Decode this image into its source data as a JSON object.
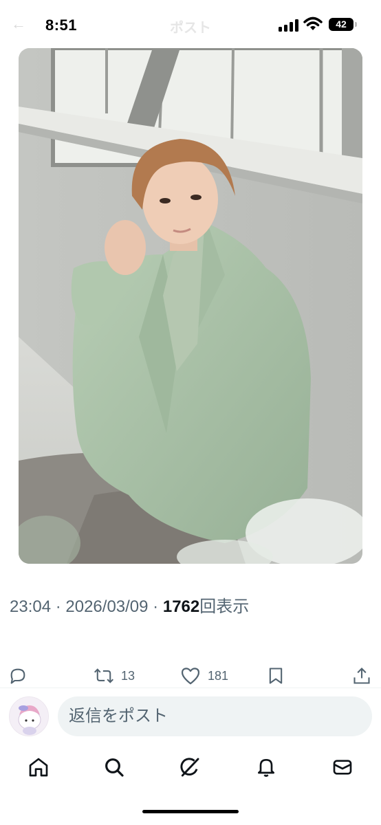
{
  "status_bar": {
    "time": "8:51",
    "battery": "42"
  },
  "header": {
    "title": "ポスト",
    "back_icon": "arrow-left-icon"
  },
  "post": {
    "image_alt": "photo",
    "timestamp": "23:04 · 2026/03/09 · ",
    "views": "1762",
    "views_suffix": "回表示"
  },
  "actions": {
    "reply_icon": "reply-icon",
    "repost_icon": "repost-icon",
    "repost_count": "13",
    "like_icon": "heart-icon",
    "like_count": "181",
    "bookmark_icon": "bookmark-icon",
    "share_icon": "share-icon"
  },
  "reply_bar": {
    "placeholder": "返信をポスト"
  },
  "tabs": {
    "home": "home-icon",
    "search": "search-icon",
    "grok": "grok-icon",
    "notifications": "bell-icon",
    "messages": "mail-icon"
  },
  "colors": {
    "text_primary": "#0f1419",
    "text_secondary": "#536471",
    "input_bg": "#eff3f4",
    "jacket": "#a9c2a7"
  }
}
